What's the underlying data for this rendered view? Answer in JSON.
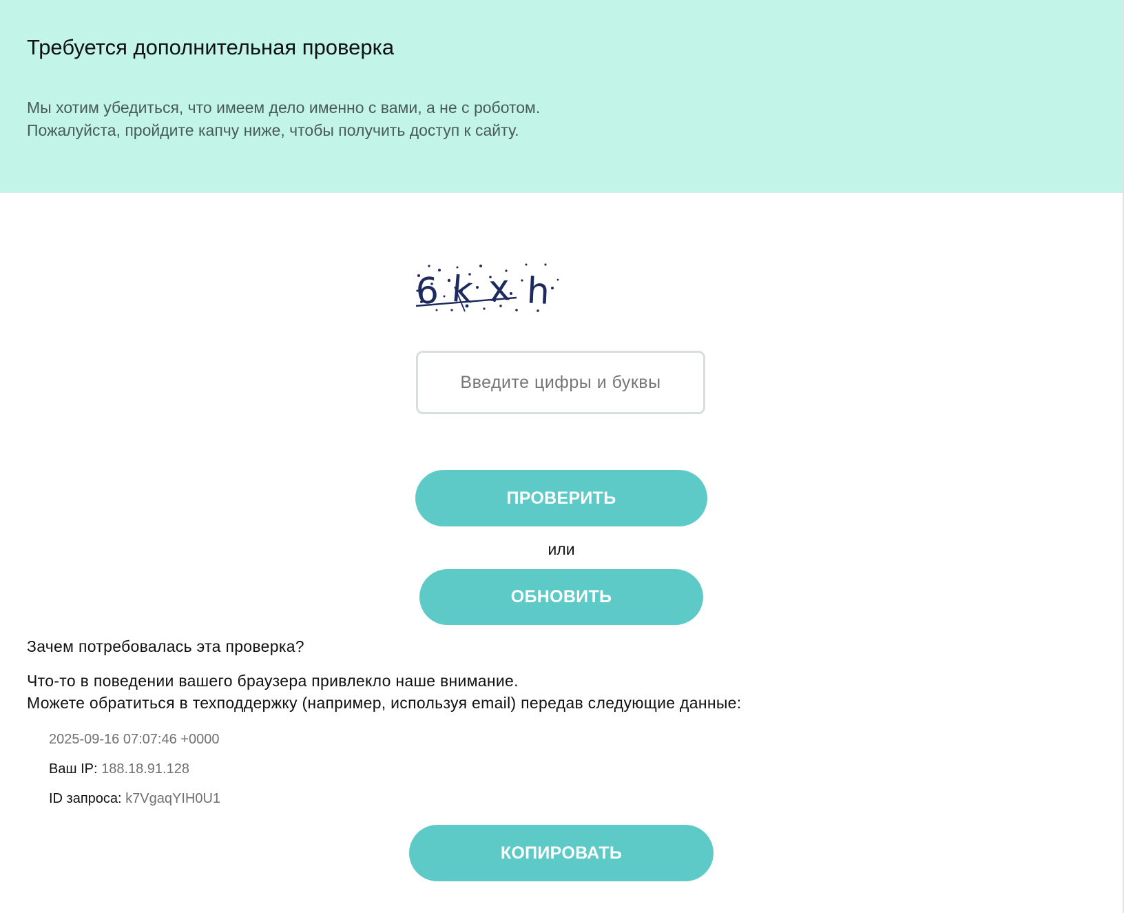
{
  "banner": {
    "title": "Требуется дополнительная проверка",
    "line1": "Мы хотим убедиться, что имеем дело именно с вами, а не с роботом.",
    "line2": "Пожалуйста, пройдите капчу ниже, чтобы получить доступ к сайту."
  },
  "captcha": {
    "text": "6kxh",
    "input_placeholder": "Введите цифры и буквы",
    "input_value": ""
  },
  "buttons": {
    "check": "ПРОВЕРИТЬ",
    "or": "или",
    "refresh": "ОБНОВИТЬ",
    "copy": "КОПИРОВАТЬ"
  },
  "why": {
    "title": "Зачем потребовалась эта проверка?",
    "line1": "Что-то в поведении вашего браузера привлекло наше внимание.",
    "line2": "Можете обратиться в техподдержку (например, используя email) передав следующие данные:"
  },
  "info": {
    "timestamp": "2025-09-16 07:07:46 +0000",
    "ip_label": "Ваш IP: ",
    "ip_value": "188.18.91.128",
    "request_label": "ID запроса: ",
    "request_value": "k7VgaqYIH0U1"
  },
  "colors": {
    "banner_bg": "#c2f5e8",
    "button_bg": "#5ecac8",
    "captcha_ink": "#1d2a5e"
  }
}
